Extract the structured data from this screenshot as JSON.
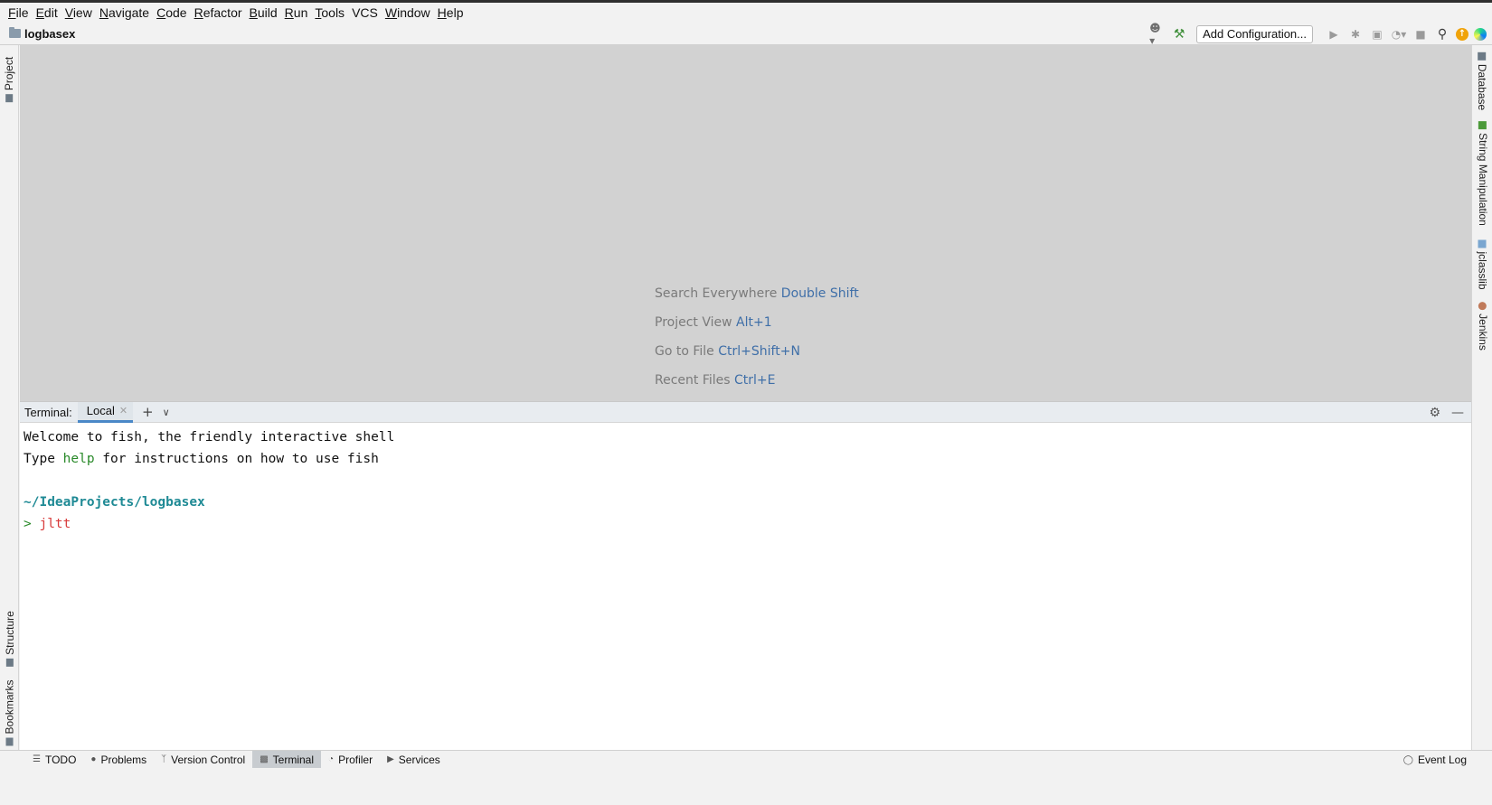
{
  "menu": [
    {
      "mnemonic": "F",
      "rest": "ile"
    },
    {
      "mnemonic": "E",
      "rest": "dit"
    },
    {
      "mnemonic": "V",
      "rest": "iew"
    },
    {
      "mnemonic": "N",
      "rest": "avigate"
    },
    {
      "mnemonic": "C",
      "rest": "ode"
    },
    {
      "mnemonic": "R",
      "rest": "efactor"
    },
    {
      "mnemonic": "B",
      "rest": "uild"
    },
    {
      "mnemonic": "R",
      "rest": "un"
    },
    {
      "mnemonic": "T",
      "rest": "ools"
    },
    {
      "mnemonic": "",
      "rest": "VCS"
    },
    {
      "mnemonic": "W",
      "rest": "indow"
    },
    {
      "mnemonic": "H",
      "rest": "elp"
    }
  ],
  "navbar": {
    "project_name": "logbasex",
    "add_configuration": "Add Configuration..."
  },
  "left_tools": {
    "project": "Project",
    "structure": "Structure",
    "bookmarks": "Bookmarks"
  },
  "right_tools": {
    "database": "Database",
    "string_manipulation": "String Manipulation",
    "jclasslib": "jclasslib",
    "jenkins": "Jenkins"
  },
  "editor_hints": [
    {
      "label": "Search Everywhere",
      "key": "Double Shift"
    },
    {
      "label": "Project View",
      "key": "Alt+1"
    },
    {
      "label": "Go to File",
      "key": "Ctrl+Shift+N"
    },
    {
      "label": "Recent Files",
      "key": "Ctrl+E"
    }
  ],
  "terminal": {
    "title": "Terminal:",
    "tab_label": "Local",
    "line1": "Welcome to fish, the friendly interactive shell",
    "line2_pre": "Type ",
    "line2_cmd": "help",
    "line2_post": " for instructions on how to use fish",
    "cwd": "~/IdeaProjects/logbasex",
    "prompt": "> ",
    "command": "jltt"
  },
  "statusbar": {
    "todo": "TODO",
    "problems": "Problems",
    "version_control": "Version Control",
    "terminal": "Terminal",
    "profiler": "Profiler",
    "services": "Services",
    "event_log": "Event Log"
  },
  "colors": {
    "accent": "#4a88c7",
    "hint_key": "#3f6fa8",
    "shell_green": "#2a8a2a",
    "shell_cyan": "#1f8a95",
    "shell_red": "#d83b3b"
  }
}
